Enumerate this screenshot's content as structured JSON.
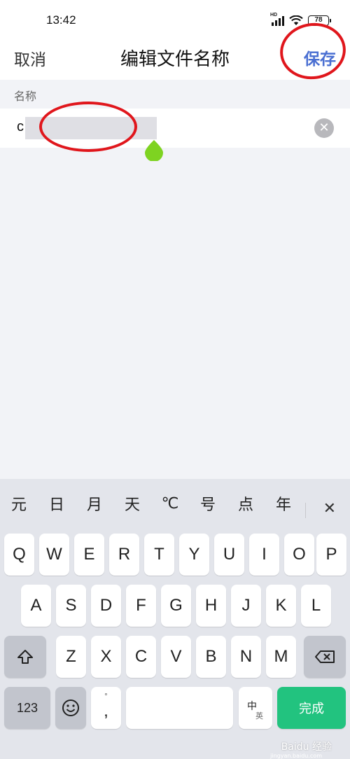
{
  "status_bar": {
    "time": "13:42",
    "network": "HD",
    "battery": "78"
  },
  "header": {
    "cancel_label": "取消",
    "title": "编辑文件名称",
    "save_label": "保存"
  },
  "name_field": {
    "label": "名称",
    "value": "c"
  },
  "keyboard": {
    "candidates": [
      "元",
      "日",
      "月",
      "天",
      "℃",
      "号",
      "点",
      "年"
    ],
    "close_label": "✕",
    "row1": [
      "Q",
      "W",
      "E",
      "R",
      "T",
      "Y",
      "U",
      "I",
      "O",
      "P"
    ],
    "row2": [
      "A",
      "S",
      "D",
      "F",
      "G",
      "H",
      "J",
      "K",
      "L"
    ],
    "row3": [
      "Z",
      "X",
      "C",
      "V",
      "B",
      "N",
      "M"
    ],
    "numbers_label": "123",
    "punct_top": "°",
    "punct_main": ",",
    "lang_zh": "中",
    "lang_en": "英",
    "done_label": "完成",
    "shift_icon": "shift-icon",
    "backspace_icon": "backspace-icon",
    "emoji_icon": "emoji-icon"
  },
  "watermark": {
    "text": "Baidu 经验",
    "sub": "jingyan.baidu.com"
  },
  "colors": {
    "accent": "#4a6fd2",
    "annotation": "#e0161c",
    "done_key": "#22c37f",
    "cursor_handle": "#7ed321"
  }
}
